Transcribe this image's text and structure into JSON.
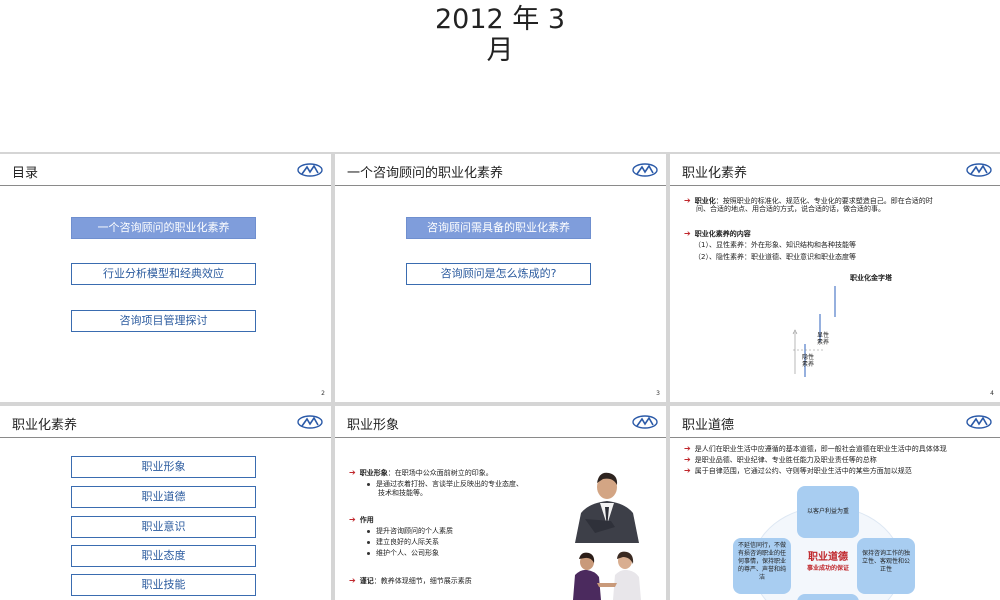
{
  "top": {
    "title_line1": "2012 年 3",
    "title_line2": "月"
  },
  "slides": {
    "s2": {
      "title": "目录",
      "page": "2",
      "items": [
        "一个咨询顾问的职业化素养",
        "行业分析模型和经典效应",
        "咨询项目管理探讨"
      ]
    },
    "s3": {
      "title": "一个咨询顾问的职业化素养",
      "page": "3",
      "items": [
        "咨询顾问需具备的职业化素养",
        "咨询顾问是怎么炼成的?"
      ]
    },
    "s4": {
      "title": "职业化素养",
      "page": "4",
      "def_label": "职业化",
      "def_text": "：按照职业的标准化、规范化、专业化的要求塑造自己。即在合适的时",
      "def_text2": "间、合适的地点、用合适的方式，说合适的话，做合适的事。",
      "content_label": "职业化素养的内容",
      "item1": "（1）、显性素养：外在形象、知识结构和各种技能等",
      "item2": "（2）、隐性素养：职业道德、职业意识和职业态度等",
      "pyramid_title": "职业化金字塔",
      "explicit": "显性素养",
      "implicit": "隐性素养"
    },
    "s5": {
      "title": "职业化素养",
      "items": [
        "职业形象",
        "职业道德",
        "职业意识",
        "职业态度",
        "职业技能"
      ]
    },
    "s6": {
      "title": "职业形象",
      "def_label": "职业形象",
      "def_text": "：在职场中公众面前树立的印象。",
      "def_sub1": "是通过衣着打扮、言谈举止反映出的专业态度、",
      "def_sub2": "技术和技能等。",
      "role_label": "作用",
      "roles": [
        "提升咨询顾问的个人素质",
        "建立良好的人际关系",
        "维护个人、公司形象"
      ],
      "motto_label": "谨记",
      "motto_text": "：教养体现细节，细节展示素质"
    },
    "s7": {
      "title": "职业道德",
      "bullets": [
        "是人们在职业生活中应遵循的基本道德，即一般社会道德在职业生活中的具体体现",
        "是职业品德、职业纪律、专业胜任能力及职业责任等的总称",
        "属于自律范围，它通过公约、守则等对职业生活中的某些方面加以规范"
      ],
      "top_bubble": "以客户利益为重",
      "left_bubble": "不延信同行，不做有损咨询职业的任何事情，保持职业的尊严、声誉和纯洁",
      "right_bubble": "保持咨询工作的独立性、客观性和公正性",
      "center_title": "职业道德",
      "center_sub": "事业成功的保证"
    }
  }
}
